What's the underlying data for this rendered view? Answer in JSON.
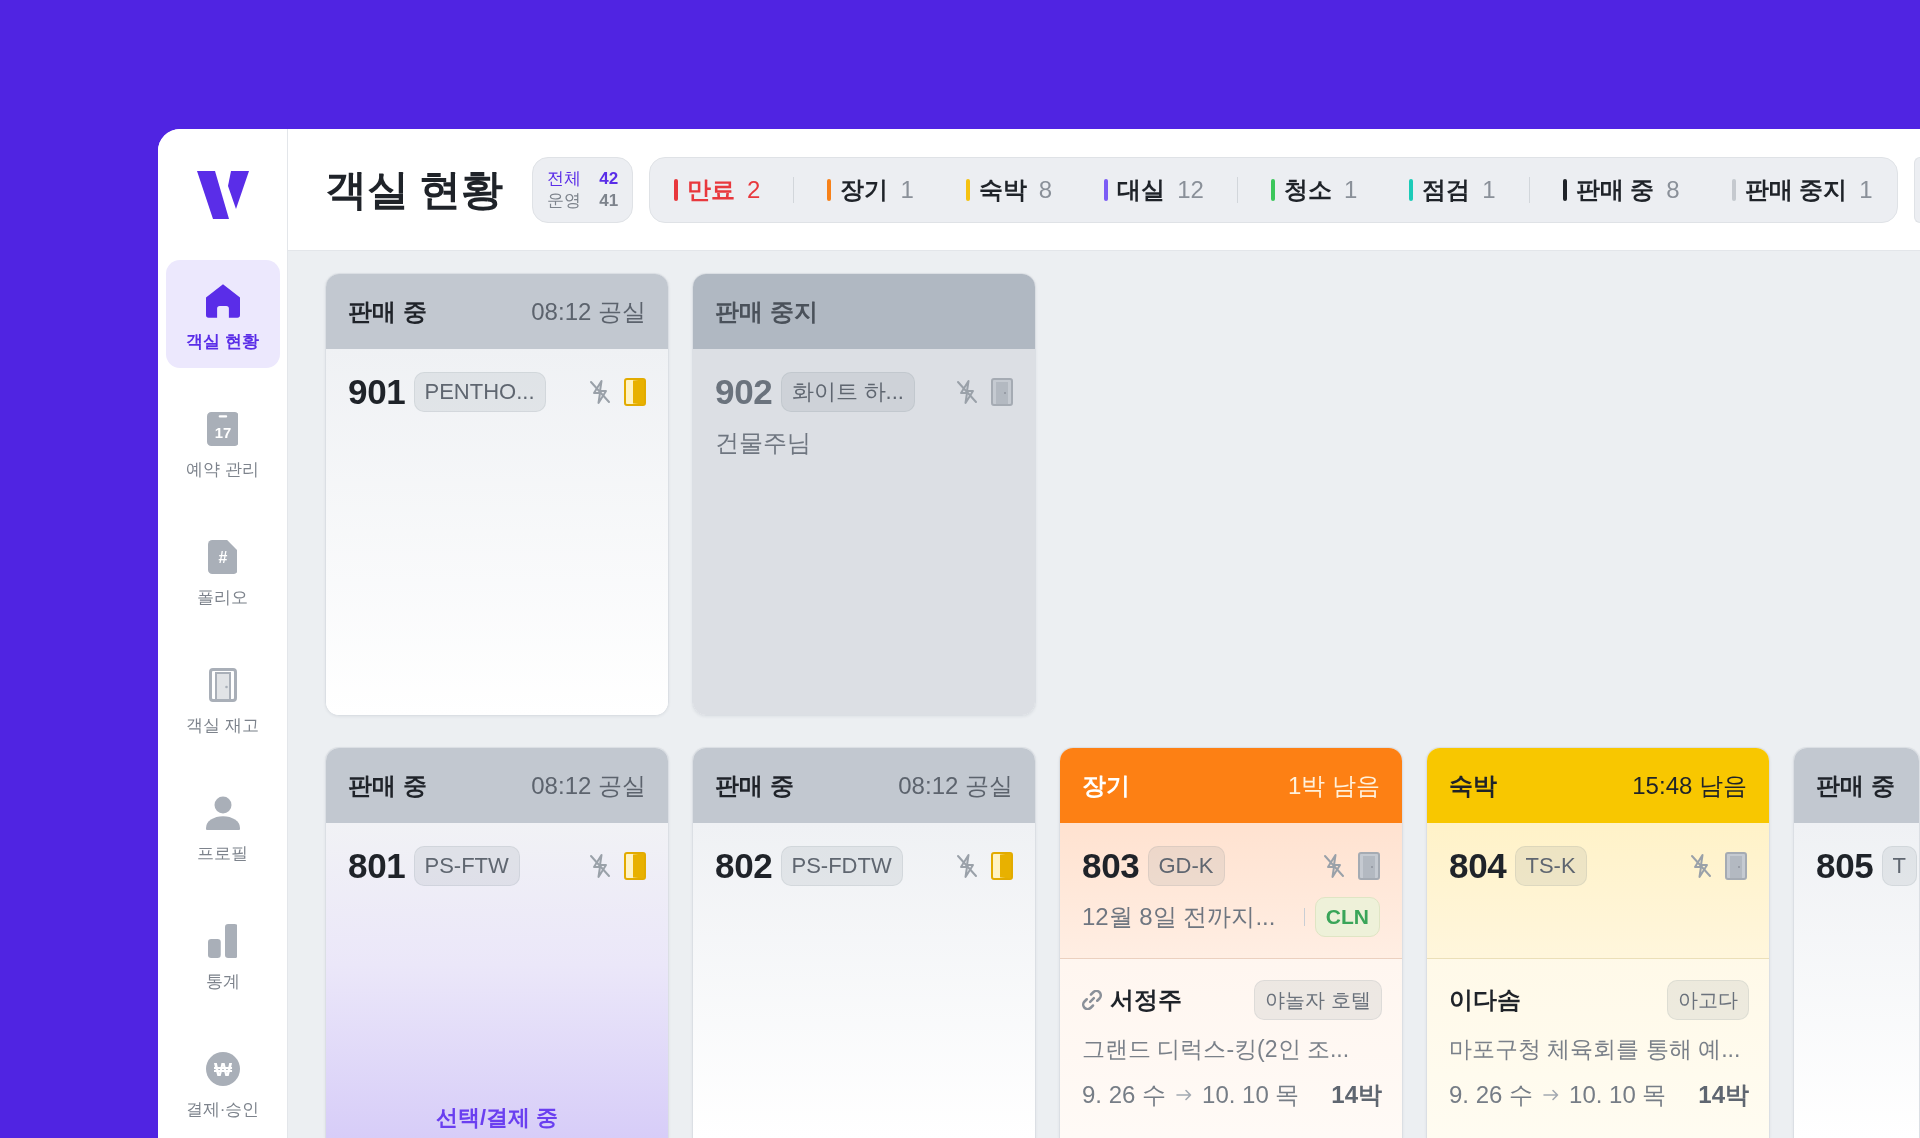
{
  "sidebar": {
    "items": [
      {
        "label": "객실 현황",
        "selected": true
      },
      {
        "label": "예약 관리",
        "icon_text": "17",
        "selected": false
      },
      {
        "label": "폴리오",
        "icon_text": "#",
        "selected": false
      },
      {
        "label": "객실 재고",
        "selected": false
      },
      {
        "label": "프로필",
        "selected": false
      },
      {
        "label": "통계",
        "selected": false
      },
      {
        "label": "결제·승인",
        "icon_text": "₩",
        "selected": false
      }
    ]
  },
  "header": {
    "title": "객실 현황",
    "summary": [
      {
        "kind": "total",
        "label": "전체",
        "value": "42"
      },
      {
        "kind": "operating",
        "label": "운영",
        "value": "41"
      }
    ],
    "filters": [
      {
        "items": [
          {
            "label": "만료",
            "count": "2",
            "color": "#e8383d",
            "alert": true
          }
        ]
      },
      {
        "items": [
          {
            "label": "장기",
            "count": "1",
            "color": "#f7811a",
            "alert": false
          },
          {
            "label": "숙박",
            "count": "8",
            "color": "#f5c211",
            "alert": false
          },
          {
            "label": "대실",
            "count": "12",
            "color": "#7b5cf5",
            "alert": false
          }
        ]
      },
      {
        "items": [
          {
            "label": "청소",
            "count": "1",
            "color": "#3cc65b",
            "alert": false
          },
          {
            "label": "점검",
            "count": "1",
            "color": "#1ccbb8",
            "alert": false
          }
        ]
      },
      {
        "items": [
          {
            "label": "판매 중",
            "count": "8",
            "color": "#1f2329",
            "alert": false
          },
          {
            "label": "판매 중지",
            "count": "1",
            "color": "#c5c9cf",
            "alert": false
          }
        ]
      }
    ]
  },
  "rooms": {
    "rows": [
      {
        "cards": [
          {
            "kind": "vacant",
            "status": "판매 중",
            "time": "08:12 공실",
            "number": "901",
            "room_type": "PENTHO...",
            "door_active": true
          },
          {
            "kind": "stopped",
            "status": "판매 중지",
            "number": "902",
            "room_type": "화이트 하...",
            "door_active": false,
            "note": "건물주님"
          }
        ]
      },
      {
        "cards": [
          {
            "kind": "vacant",
            "status": "판매 중",
            "time": "08:12 공실",
            "number": "801",
            "room_type": "PS-FTW",
            "door_active": true,
            "payment": "선택/결제 중"
          },
          {
            "kind": "vacant",
            "status": "판매 중",
            "time": "08:12 공실",
            "number": "802",
            "room_type": "PS-FDTW",
            "door_active": true
          },
          {
            "kind": "long",
            "status": "장기",
            "time": "1박 남음",
            "number": "803",
            "room_type": "GD-K",
            "door_active": false,
            "note": "12월 8일 전까지...",
            "code": "CLN",
            "guest": {
              "name": "서정주",
              "linked": true,
              "channel": "야놀자 호텔",
              "product": "그랜드 디럭스-킹(2인 조...",
              "check_in": "9. 26 수",
              "check_out": "10. 10 목",
              "nights": "14박"
            }
          },
          {
            "kind": "stay",
            "status": "숙박",
            "time": "15:48 남음",
            "number": "804",
            "room_type": "TS-K",
            "door_active": false,
            "guest": {
              "name": "이다솜",
              "linked": false,
              "channel": "아고다",
              "product": "마포구청 체육회를 통해 예...",
              "check_in": "9. 26 수",
              "check_out": "10. 10 목",
              "nights": "14박"
            }
          },
          {
            "kind": "vacant",
            "status": "판매 중",
            "number": "805",
            "room_type": "T"
          }
        ]
      }
    ]
  }
}
